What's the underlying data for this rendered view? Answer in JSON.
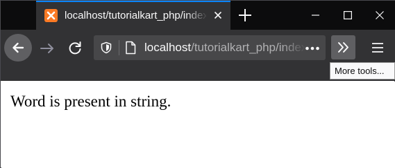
{
  "tab": {
    "title": "localhost/tutorialkart_php/index.php"
  },
  "window": {
    "controls": [
      "minimize-icon",
      "maximize-icon",
      "close-icon"
    ]
  },
  "navbar": {
    "icons": [
      "back-arrow-icon",
      "forward-arrow-icon",
      "reload-icon",
      "shield-icon",
      "page-icon",
      "more-dots-icon",
      "chevron-double-right-icon",
      "hamburger-menu-icon"
    ]
  },
  "url": {
    "host": "localhost",
    "path": "/tutorialkart_php/index.php"
  },
  "tooltip": {
    "text": "More tools..."
  },
  "content": {
    "text": "Word is present in string."
  },
  "colors": {
    "tabstrip": "#0c0c0d",
    "toolbar": "#323234",
    "urlbar": "#474749",
    "active_tab_line": "#0a84ff",
    "favicon": "#fb7a24"
  }
}
